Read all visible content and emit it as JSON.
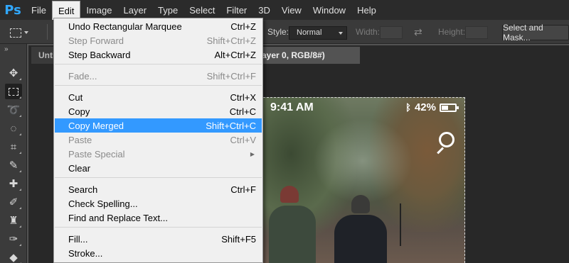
{
  "app": {
    "logo": "Ps"
  },
  "menubar": {
    "items": [
      {
        "label": "File"
      },
      {
        "label": "Edit",
        "active": true
      },
      {
        "label": "Image"
      },
      {
        "label": "Layer"
      },
      {
        "label": "Type"
      },
      {
        "label": "Select"
      },
      {
        "label": "Filter"
      },
      {
        "label": "3D"
      },
      {
        "label": "View"
      },
      {
        "label": "Window"
      },
      {
        "label": "Help"
      }
    ]
  },
  "options": {
    "style_label": "Style:",
    "style_value": "Normal",
    "width_label": "Width:",
    "height_label": "Height:",
    "select_mask_label": "Select and Mask..."
  },
  "tabs": [
    {
      "label": "Unti",
      "active": false
    },
    {
      "label": "ayer 0, RGB/8#)",
      "active": true
    }
  ],
  "edit_menu": {
    "items": [
      {
        "label": "Undo Rectangular Marquee",
        "shortcut": "Ctrl+Z",
        "enabled": true
      },
      {
        "label": "Step Forward",
        "shortcut": "Shift+Ctrl+Z",
        "enabled": false
      },
      {
        "label": "Step Backward",
        "shortcut": "Alt+Ctrl+Z",
        "enabled": true
      },
      {
        "label": "Fade...",
        "shortcut": "Shift+Ctrl+F",
        "enabled": false
      },
      {
        "label": "Cut",
        "shortcut": "Ctrl+X",
        "enabled": true
      },
      {
        "label": "Copy",
        "shortcut": "Ctrl+C",
        "enabled": true
      },
      {
        "label": "Copy Merged",
        "shortcut": "Shift+Ctrl+C",
        "enabled": true,
        "highlighted": true
      },
      {
        "label": "Paste",
        "shortcut": "Ctrl+V",
        "enabled": false
      },
      {
        "label": "Paste Special",
        "shortcut": "",
        "enabled": false,
        "submenu": true
      },
      {
        "label": "Clear",
        "shortcut": "",
        "enabled": true
      },
      {
        "label": "Search",
        "shortcut": "Ctrl+F",
        "enabled": true
      },
      {
        "label": "Check Spelling...",
        "shortcut": "",
        "enabled": true
      },
      {
        "label": "Find and Replace Text...",
        "shortcut": "",
        "enabled": true
      },
      {
        "label": "Fill...",
        "shortcut": "Shift+F5",
        "enabled": true
      },
      {
        "label": "Stroke...",
        "shortcut": "",
        "enabled": true
      }
    ]
  },
  "canvas_image": {
    "time": "9:41 AM",
    "battery": "42%"
  },
  "colors": {
    "accent": "#3399ff",
    "ps_logo": "#31a8ff",
    "menubar_bg": "#2b2b2b",
    "menu_bg": "#f0f0f0"
  },
  "icons": {
    "toolbar": [
      "move-icon",
      "rectangular-marquee-icon",
      "lasso-icon",
      "quick-selection-icon",
      "crop-icon",
      "eyedropper-icon",
      "healing-brush-icon",
      "brush-icon",
      "clone-stamp-icon",
      "history-brush-icon",
      "eraser-icon"
    ]
  }
}
